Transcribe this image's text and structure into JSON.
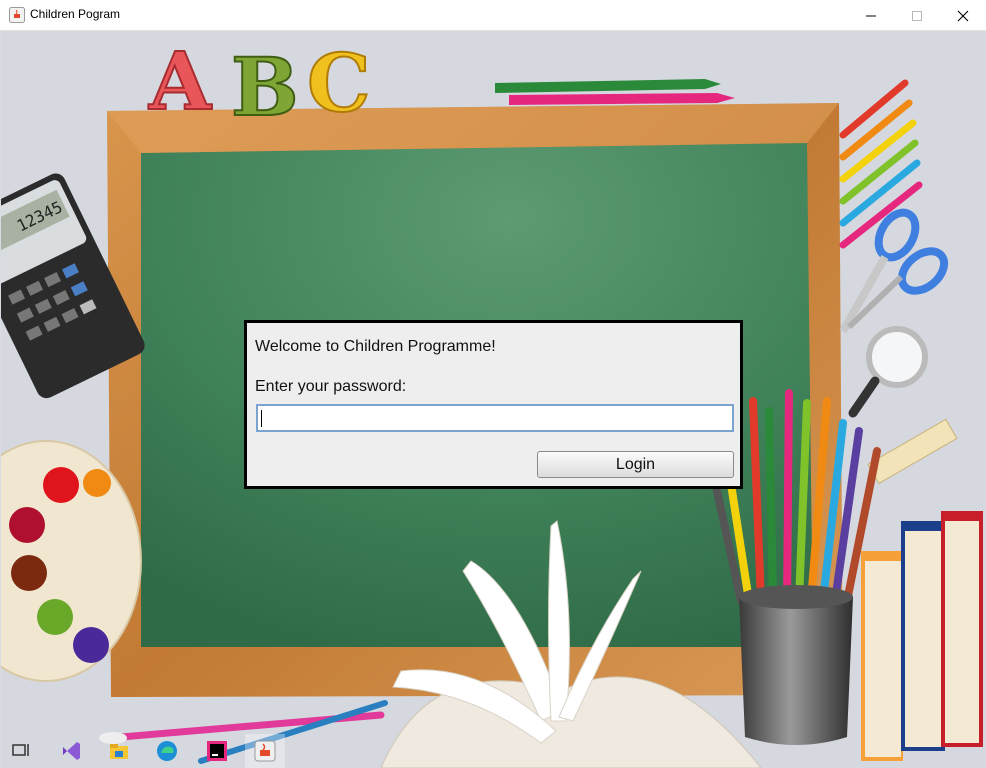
{
  "window": {
    "title": "Children Pogram"
  },
  "chalkboard_art": {
    "abc_letters": [
      "A",
      "B",
      "C"
    ],
    "calculator_display": "12345"
  },
  "login": {
    "welcome_text": "Welcome to Children Programme!",
    "password_label": "Enter your password:",
    "password_value": "",
    "login_label": "Login"
  },
  "taskbar": {
    "items": [
      "task-view-icon",
      "visual-studio-icon",
      "file-explorer-icon",
      "edge-icon",
      "intellij-icon",
      "java-icon"
    ]
  },
  "colors": {
    "chalkboard": "#3f8a60",
    "frame": "#c8843e",
    "panel_border": "#000000",
    "input_border": "#7aa3cf"
  }
}
